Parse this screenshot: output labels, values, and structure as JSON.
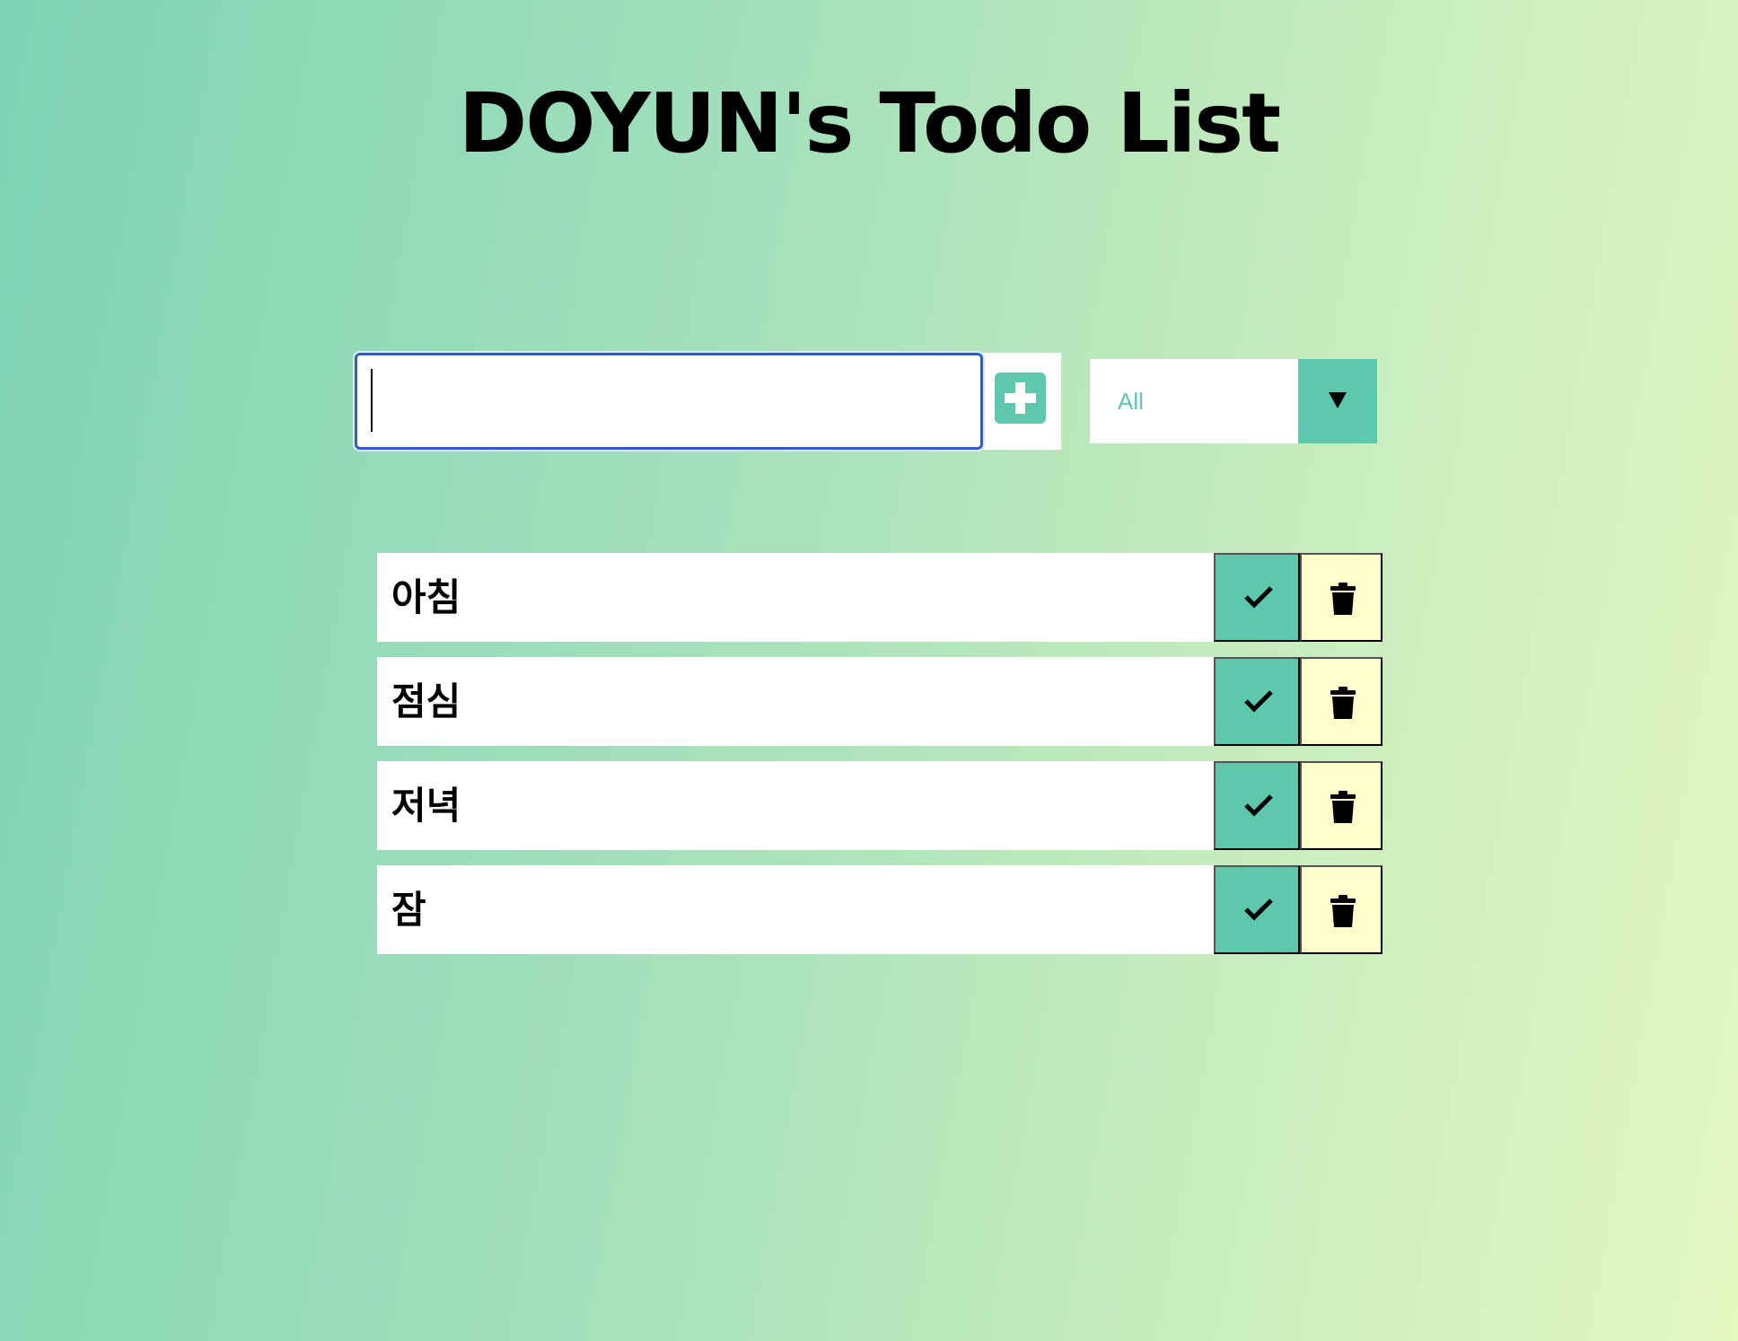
{
  "header": {
    "title": "DOYUN's Todo List"
  },
  "form": {
    "input_value": "",
    "add_icon": "plus-square-icon"
  },
  "filter": {
    "selected": "All",
    "arrow_icon": "caret-down-icon"
  },
  "todos": [
    {
      "text": "아침"
    },
    {
      "text": "점심"
    },
    {
      "text": "저녁"
    },
    {
      "text": "잠"
    }
  ],
  "icons": {
    "complete": "check-icon",
    "delete": "trash-icon"
  },
  "colors": {
    "accent": "#5ec8ad",
    "trash_bg": "#fffdcc",
    "gradient_start": "#7fd4b5",
    "gradient_end": "#e4f8c1"
  }
}
